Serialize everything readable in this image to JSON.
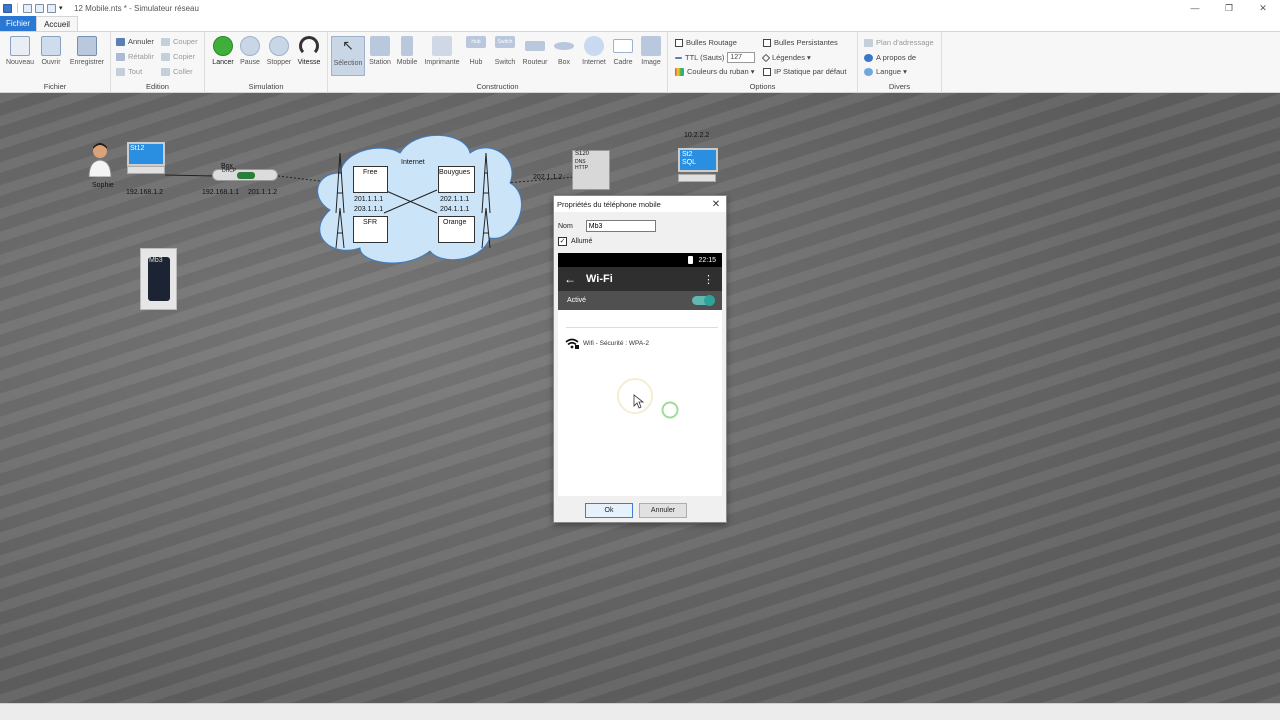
{
  "window": {
    "title": "12 Mobile.nts * - Simulateur réseau",
    "controls": [
      "—",
      "❐",
      "✕"
    ]
  },
  "tabs": {
    "file": "Fichier",
    "home": "Accueil"
  },
  "ribbon": {
    "fichier": {
      "label": "Fichier",
      "new": "Nouveau",
      "open": "Ouvrir",
      "save": "Enregistrer"
    },
    "edition": {
      "label": "Edition",
      "undo": "Annuler",
      "redo": "Rétablir",
      "all": "Tout",
      "cut": "Couper",
      "copy": "Copier",
      "paste": "Coller"
    },
    "simulation": {
      "label": "Simulation",
      "start": "Lancer",
      "pause": "Pause",
      "stop": "Stopper",
      "speed": "Vitesse"
    },
    "construction": {
      "label": "Construction",
      "selection": "Sélection",
      "station": "Station",
      "mobile": "Mobile",
      "printer": "Imprimante",
      "hub": "Hub",
      "switch": "Switch",
      "router": "Routeur",
      "box": "Box",
      "internet": "Internet",
      "frame": "Cadre",
      "image": "Image",
      "hub_small": "Hub",
      "switch_small": "Switch"
    },
    "options": {
      "label": "Options",
      "routing_bubbles": "Bulles Routage",
      "persistent_bubbles": "Bulles Persistantes",
      "ttl_label": "TTL (Sauts)",
      "ttl_value": "127",
      "legends": "Légendes ▾",
      "ribbon_colors": "Couleurs du ruban ▾",
      "static_ip": "IP Statique par défaut"
    },
    "divers": {
      "label": "Divers",
      "address_plan": "Plan d'adressage",
      "about": "A propos de",
      "language": "Langue ▾"
    }
  },
  "topology": {
    "user_name": "Sophie",
    "st12_label": "St12",
    "st12_ip": "192.168.1.2",
    "box_label": "Box",
    "box_dhcp": "DHCP",
    "box_ip_lan": "192.168.1.1",
    "box_ip_wan": "201.1.1.2",
    "internet_label": "Internet",
    "isp_free": "Free",
    "isp_bouygues": "Bouygues",
    "isp_sfr": "SFR",
    "isp_orange": "Orange",
    "ip_201": "201.1.1.1",
    "ip_203": "203.1.1.1",
    "ip_202": "202.1.1.1",
    "ip_204": "204.1.1.1",
    "server_link_ip": "202.1.1.2",
    "server_label": "S120",
    "server_services": "DNS HTTP",
    "sql_ip": "10.2.2.2",
    "sql_label": "St2",
    "sql_service": "SQL",
    "mobile_label": "Mb3"
  },
  "dialog": {
    "title": "Propriétés du téléphone mobile",
    "close": "✕",
    "name_label": "Nom",
    "name_value": "Mb3",
    "on_label": "Allumé",
    "on_checked": true,
    "phone": {
      "time": "22:15",
      "screen_title": "Wi-Fi",
      "back_icon": "←",
      "menu_icon": "⋮",
      "toggle_label": "Activé",
      "toggle_on": true,
      "network": "Wifi - Sécurité : WPA-2"
    },
    "ok": "Ok",
    "cancel": "Annuler"
  },
  "colors": {
    "accent": "#2b77d4",
    "ribbon_bg": "#f7f7f7",
    "canvas_bg": "#6d6d6d",
    "wifi_toggle": "#2fa39a",
    "cloud": "#c9e3f7"
  }
}
